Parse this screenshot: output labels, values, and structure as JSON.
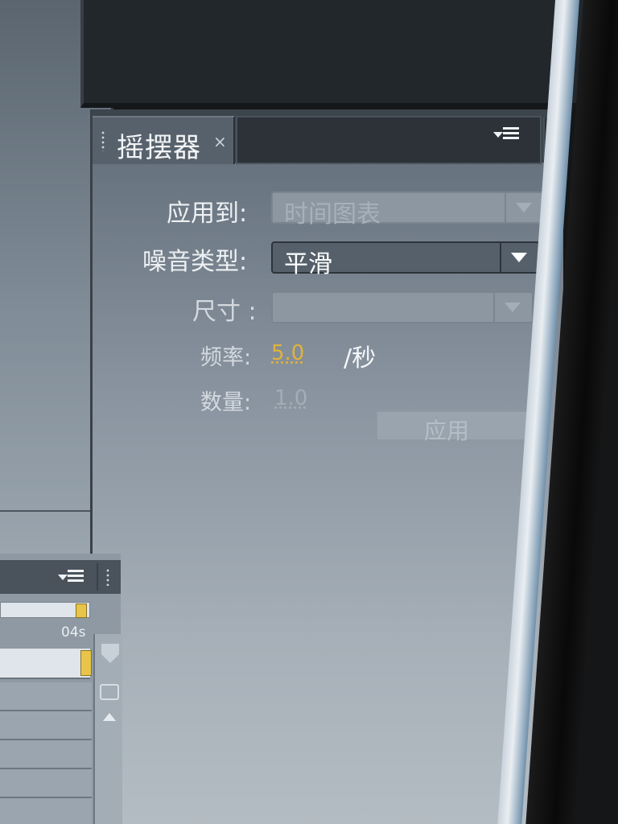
{
  "wiggler_panel": {
    "title": "摇摆器",
    "close_glyph": "×",
    "apply_to": {
      "label": "应用到:",
      "value": "时间图表",
      "disabled": true
    },
    "noise_type": {
      "label": "噪音类型:",
      "value": "平滑"
    },
    "dimension": {
      "label": "尺寸 :",
      "value": "",
      "disabled": true
    },
    "frequency": {
      "label": "频率:",
      "value": "5.0",
      "unit": "/秒"
    },
    "magnitude": {
      "label": "数量:",
      "value": "1.0"
    },
    "apply_button": {
      "label": "应用",
      "disabled": true
    }
  },
  "timeline": {
    "time_label": "04s"
  },
  "colors": {
    "frequency_value": "#e2b23a",
    "magnitude_value": "#a3adb6",
    "panel_text": "#eef1f3"
  }
}
